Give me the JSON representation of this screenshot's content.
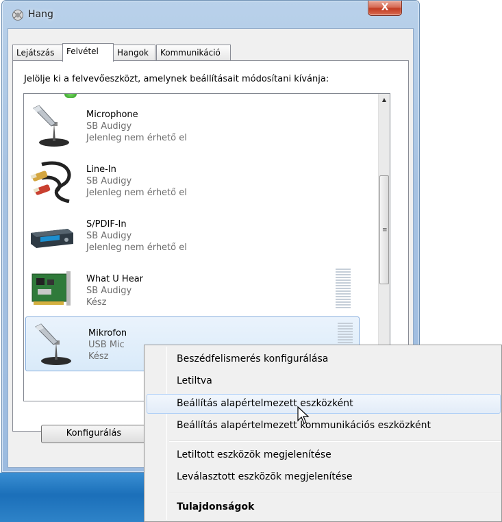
{
  "window": {
    "title": "Hang",
    "close_label": "X"
  },
  "tabs": [
    {
      "label": "Lejátszás"
    },
    {
      "label": "Felvétel"
    },
    {
      "label": "Hangok"
    },
    {
      "label": "Kommunikáció"
    }
  ],
  "panel": {
    "instruction": "Jelölje ki a felvevőeszközt, amelynek beállításait módosítani kívánja:",
    "devices": [
      {
        "name": "Microphone",
        "driver": "SB Audigy",
        "status": "Jelenleg nem érhető el",
        "icon": "microphone-icon"
      },
      {
        "name": "Line-In",
        "driver": "SB Audigy",
        "status": "Jelenleg nem érhető el",
        "icon": "cable-icon"
      },
      {
        "name": "S/PDIF-In",
        "driver": "SB Audigy",
        "status": "Jelenleg nem érhető el",
        "icon": "spdif-device-icon"
      },
      {
        "name": "What U Hear",
        "driver": "SB Audigy",
        "status": "Kész",
        "icon": "sound-card-icon"
      },
      {
        "name": "Mikrofon",
        "driver": "USB Mic",
        "status": "Kész",
        "icon": "microphone-icon"
      }
    ],
    "configure_label": "Konfigurálás"
  },
  "context_menu": {
    "items": [
      {
        "label": "Beszédfelismerés konfigurálása"
      },
      {
        "label": "Letiltva"
      },
      {
        "label": "Beállítás alapértelmezett eszközként"
      },
      {
        "label": "Beállítás alapértelmezett kommunikációs eszközként"
      },
      {
        "label": "Letiltott eszközök megjelenítése"
      },
      {
        "label": "Leválasztott eszközök megjelenítése"
      },
      {
        "label": "Tulajdonságok"
      }
    ]
  },
  "colors": {
    "accent": "#84acdd",
    "close": "#c23c23",
    "taskbar": "#1b6fb9"
  }
}
